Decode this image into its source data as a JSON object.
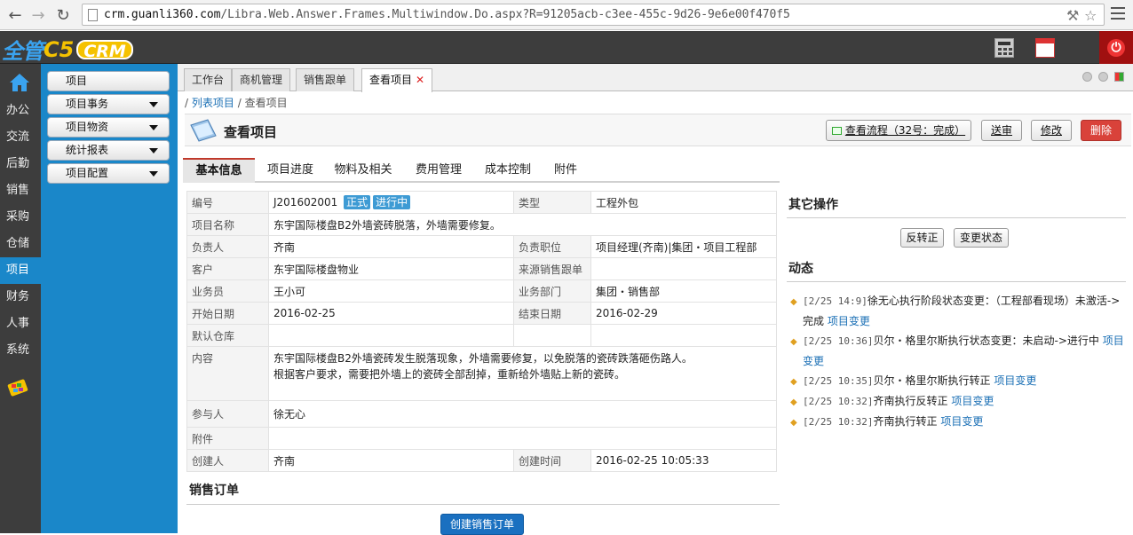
{
  "browser": {
    "url_prefix": "crm.guanli360.com",
    "url_path": "/Libra.Web.Answer.Frames.Multiwindow.Do.aspx?R=91205acb-c3ee-455c-9d26-9e6e00f470f5"
  },
  "app": {
    "logo_cn": "全管",
    "logo_c5": "C5",
    "logo_crm": "CRM"
  },
  "leftnav": {
    "items": [
      "办公",
      "交流",
      "后勤",
      "销售",
      "采购",
      "仓储",
      "项目",
      "财务",
      "人事",
      "系统"
    ],
    "active": "项目"
  },
  "submenu": {
    "items": [
      "项目",
      "项目事务",
      "项目物资",
      "统计报表",
      "项目配置"
    ]
  },
  "tabs": [
    "工作台",
    "商机管理",
    "销售跟单",
    "查看项目"
  ],
  "active_tab": "查看项目",
  "breadcrumb": {
    "link": "列表项目",
    "sep": "/",
    "current": "查看项目"
  },
  "page_title": "查看项目",
  "actions": {
    "flow": "查看流程（32号：完成）",
    "send": "送审",
    "edit": "修改",
    "delete": "删除"
  },
  "subtabs": [
    "基本信息",
    "项目进度",
    "物料及相关",
    "费用管理",
    "成本控制",
    "附件"
  ],
  "info": {
    "labels": {
      "code": "编号",
      "type": "类型",
      "name": "项目名称",
      "owner": "负责人",
      "owner_position": "负责职位",
      "customer": "客户",
      "source": "来源销售跟单",
      "salesman": "业务员",
      "dept": "业务部门",
      "start": "开始日期",
      "end": "结束日期",
      "warehouse": "默认仓库",
      "content": "内容",
      "participants": "参与人",
      "attachment": "附件",
      "creator": "创建人",
      "created": "创建时间"
    },
    "values": {
      "code": "J201602001",
      "badge1": "正式",
      "badge2": "进行中",
      "type": "工程外包",
      "name": "东宇国际楼盘B2外墙瓷砖脱落，外墙需要修复。",
      "owner": "齐南",
      "owner_position": "项目经理(齐南)|集团・项目工程部",
      "customer": "东宇国际楼盘物业",
      "source": "",
      "salesman": "王小可",
      "dept": "集团・销售部",
      "start": "2016-02-25",
      "end": "2016-02-29",
      "warehouse": "",
      "content_line1": "东宇国际楼盘B2外墙瓷砖发生脱落现象，外墙需要修复，以免脱落的瓷砖跌落砸伤路人。",
      "content_line2": "根据客户要求，需要把外墙上的瓷砖全部刮掉，重新给外墙贴上新的瓷砖。",
      "participants": "徐无心",
      "attachment": "",
      "creator": "齐南",
      "created": "2016-02-25 10:05:33"
    }
  },
  "sales_order": {
    "title": "销售订单",
    "create_button": "创建销售订单"
  },
  "other_ops": {
    "title": "其它操作",
    "btn1": "反转正",
    "btn2": "变更状态"
  },
  "activity": {
    "title": "动态",
    "items": [
      {
        "time": "[2/25 14:9]",
        "text": "徐无心执行阶段状态变更：（工程部看现场）未激活->完成",
        "link": "项目变更"
      },
      {
        "time": "[2/25 10:36]",
        "text": "贝尔・格里尔斯执行状态变更：未启动->进行中",
        "link": "项目变更"
      },
      {
        "time": "[2/25 10:35]",
        "text": "贝尔・格里尔斯执行转正",
        "link": "项目变更"
      },
      {
        "time": "[2/25 10:32]",
        "text": "齐南执行反转正",
        "link": "项目变更"
      },
      {
        "time": "[2/25 10:32]",
        "text": "齐南执行转正",
        "link": "项目变更"
      }
    ]
  },
  "colors": {
    "accent": "#1a87c9",
    "dark": "#3d3d3d",
    "danger": "#d9423a",
    "badge": "#3e9bd4"
  }
}
